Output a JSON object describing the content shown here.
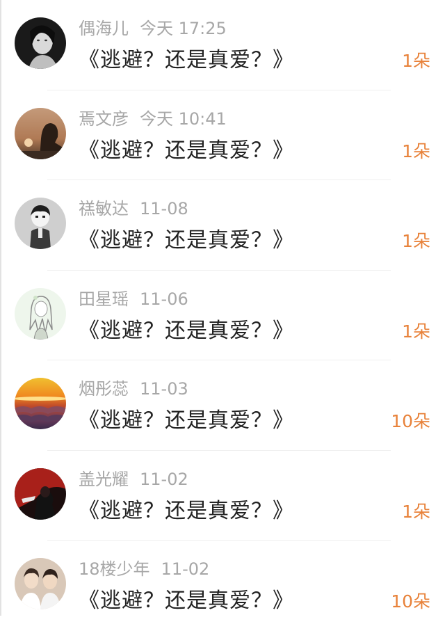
{
  "comments": [
    {
      "name": "偶海儿",
      "time": "今天 17:25",
      "text": "《逃避？还是真爱？》",
      "gift": "1朵",
      "avatar_icon": "woman-portrait-avatar"
    },
    {
      "name": "焉文彦",
      "time": "今天 10:41",
      "text": "《逃避？还是真爱？》",
      "gift": "1朵",
      "avatar_icon": "sunset-silhouette-avatar"
    },
    {
      "name": "禚敏达",
      "time": "11-08",
      "text": "《逃避？还是真爱？》",
      "gift": "1朵",
      "avatar_icon": "cartoon-boy-avatar"
    },
    {
      "name": "田星瑶",
      "time": "11-06",
      "text": "《逃避？还是真爱？》",
      "gift": "1朵",
      "avatar_icon": "anime-sketch-avatar"
    },
    {
      "name": "烟彤蕊",
      "time": "11-03",
      "text": "《逃避？还是真爱？》",
      "gift": "10朵",
      "avatar_icon": "sea-of-clouds-avatar"
    },
    {
      "name": "盖光耀",
      "time": "11-02",
      "text": "《逃避？还是真爱？》",
      "gift": "1朵",
      "avatar_icon": "red-photo-avatar"
    },
    {
      "name": "18楼少年",
      "time": "11-02",
      "text": "《逃避？还是真爱？》",
      "gift": "10朵",
      "avatar_icon": "two-boys-photo-avatar"
    }
  ],
  "colors": {
    "gift": "#e8823a",
    "meta": "#a7a7a7",
    "text": "#222222"
  }
}
